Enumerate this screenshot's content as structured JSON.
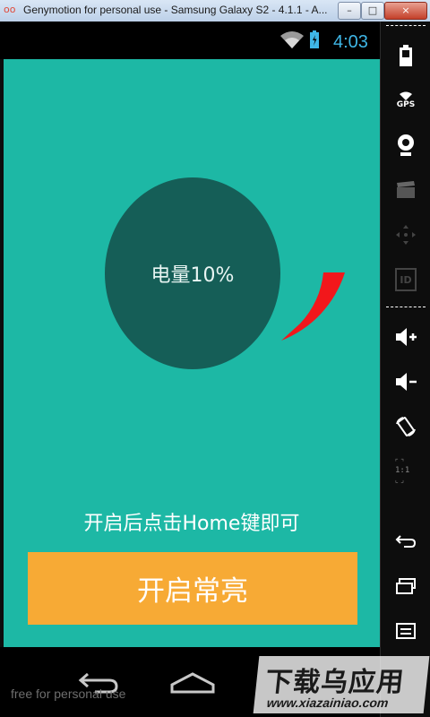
{
  "window": {
    "title": "Genymotion for personal use - Samsung Galaxy S2 - 4.1.1 - A...",
    "minimize_label": "–",
    "maximize_label": "□",
    "close_label": "×"
  },
  "status_bar": {
    "time": "4:03",
    "icons": [
      "wifi-icon",
      "battery-icon"
    ]
  },
  "app": {
    "battery_label": "电量10%",
    "battery_level_percent": 10,
    "hint": "开启后点击Home键即可",
    "button_label": "开启常亮",
    "colors": {
      "background": "#1db8a5",
      "circle": "#155e57",
      "arc": "#f2171b",
      "button": "#f7aa35",
      "clock": "#3fb6e6"
    }
  },
  "nav_bar": {
    "icons": [
      "back-icon",
      "home-icon"
    ],
    "free_note": "free for personal use"
  },
  "side_panel": {
    "gps_label": "GPS",
    "id_label": "ID",
    "ratio_label": "1:1",
    "icons": [
      "battery-icon",
      "gps-icon",
      "webcam-icon",
      "clapperboard-icon",
      "dpad-icon",
      "id-icon",
      "volume-up-icon",
      "volume-down-icon",
      "rotate-icon",
      "pixel-ratio-icon",
      "back-icon",
      "recent-apps-icon",
      "menu-icon"
    ]
  },
  "watermark": {
    "text": "下载乌应用",
    "url": "www.xiazainiao.com"
  }
}
